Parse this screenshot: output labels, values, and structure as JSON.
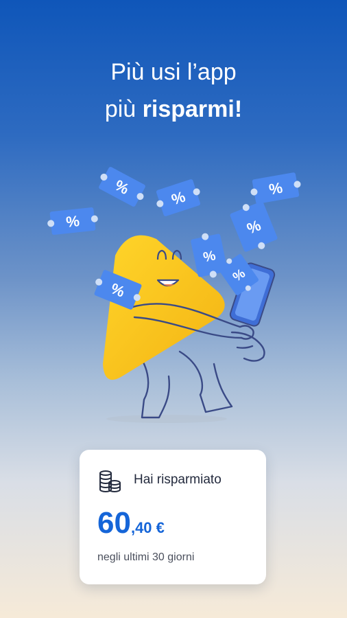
{
  "headline": {
    "line1": "Più usi l’app",
    "line2_prefix": "più",
    "line2_bold": "risparmi!"
  },
  "illustration": {
    "ticket_symbol": "%",
    "colors": {
      "ticket": "#4c88ee",
      "mascot": "#f8c51c",
      "outline": "#3a4a86"
    }
  },
  "savings_card": {
    "icon": "coins-stack-icon",
    "title": "Hai risparmiato",
    "amount_integer": "60",
    "amount_decimal": ",40 €",
    "period": "negli ultimi 30 giorni",
    "accent_color": "#1565d8"
  }
}
